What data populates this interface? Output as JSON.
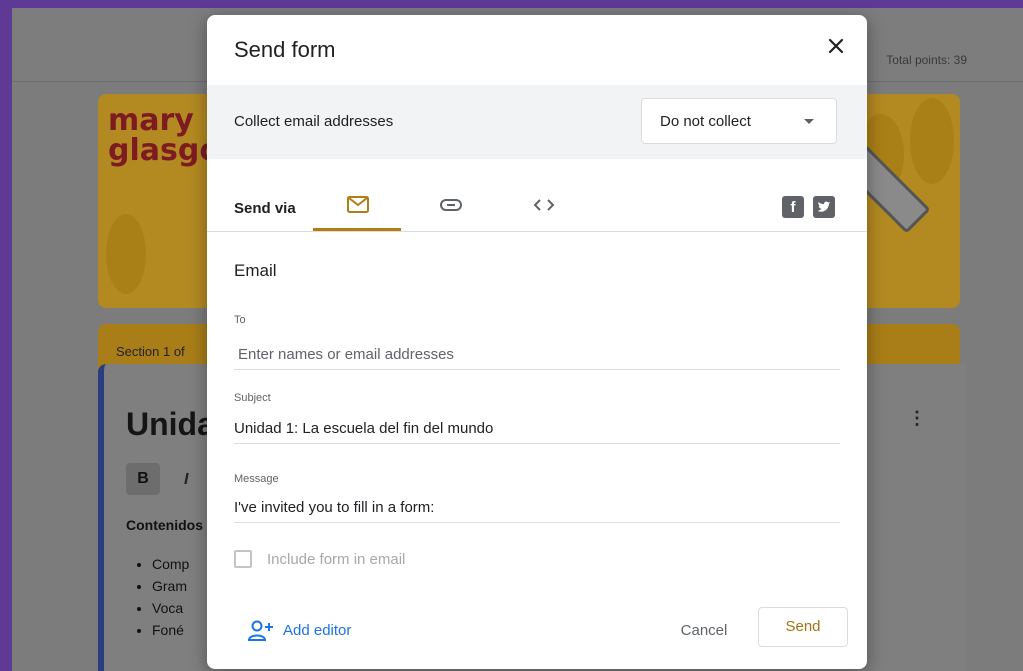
{
  "background_page": {
    "total_points": "Total points: 39",
    "logo_line1": "mary",
    "logo_line2": "glasgo",
    "section_label": "Section 1 of",
    "card_title": "Unida",
    "bold_button": "B",
    "italic_button": "I",
    "contenidos": "Contenidos",
    "list_items": [
      "Comp",
      "Gram",
      "Voca",
      "Foné"
    ]
  },
  "dialog": {
    "title": "Send form",
    "collect": {
      "label": "Collect email addresses",
      "selected": "Do not collect"
    },
    "send_via": {
      "label": "Send via",
      "tabs": [
        {
          "name": "email",
          "icon": "mail-icon",
          "active": true
        },
        {
          "name": "link",
          "icon": "link-icon",
          "active": false
        },
        {
          "name": "embed",
          "icon": "embed-code-icon",
          "active": false
        }
      ],
      "social": [
        "facebook-icon",
        "twitter-icon"
      ]
    },
    "email": {
      "heading": "Email",
      "to_label": "To",
      "to_placeholder": "Enter names or email addresses",
      "subject_label": "Subject",
      "subject_value": "Unidad 1: La escuela del fin del mundo",
      "message_label": "Message",
      "message_value": "I've invited you to fill in a form:",
      "include_form_label": "Include form in email"
    },
    "footer": {
      "add_editor": "Add editor",
      "cancel": "Cancel",
      "send": "Send"
    }
  },
  "colors": {
    "frame": "#5e3996",
    "accent": "#b07e14",
    "link": "#1a73e8"
  }
}
